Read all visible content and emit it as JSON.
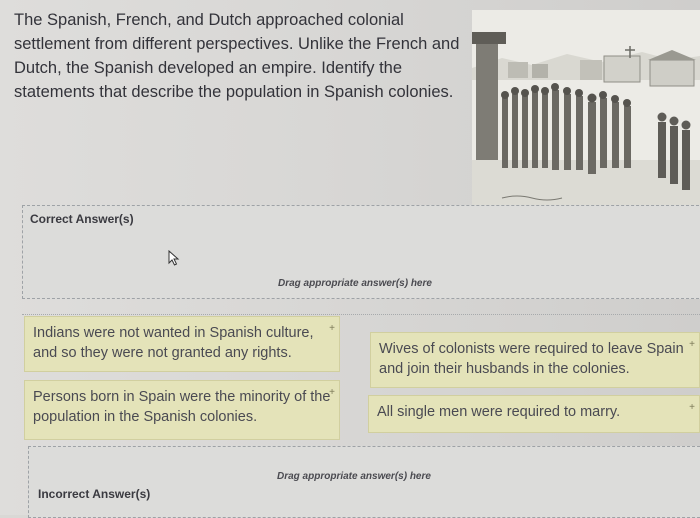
{
  "question": {
    "text": "The Spanish, French, and Dutch approached colonial settlement from different perspectives. Unlike the French and Dutch, the Spanish developed an empire. Identify the statements that describe the population in Spanish colonies."
  },
  "correct_zone": {
    "title": "Correct Answer(s)",
    "hint": "Drag appropriate answer(s) here"
  },
  "incorrect_zone": {
    "title": "Incorrect Answer(s)",
    "hint": "Drag appropriate answer(s) here"
  },
  "answer_tiles": [
    {
      "text": "Indians were not wanted in Spanish culture, and so they were not granted any rights."
    },
    {
      "text": "Wives of colonists were required to leave Spain and join their husbands in the colonies."
    },
    {
      "text": "Persons born in Spain were the minority of the population in the Spanish colonies."
    },
    {
      "text": "All single men were required to marry."
    }
  ],
  "drag_handle_symbol": "+",
  "icons": {
    "cursor": "mouse-pointer-icon",
    "illustration": "colonial-procession-image"
  },
  "colors": {
    "tile_bg": "#e4e3b9",
    "zone_border": "#9ea2a6"
  }
}
